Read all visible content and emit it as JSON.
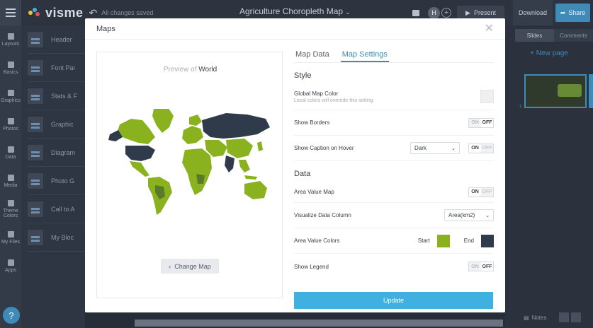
{
  "app": {
    "logo_text": "visme",
    "save_status": "All changes saved",
    "doc_title": "Agriculture Choropleth Map",
    "avatar_initial": "H",
    "present_label": "Present",
    "download_label": "Download",
    "share_label": "Share"
  },
  "rail": {
    "items": [
      "Layouts",
      "Basics",
      "Graphics",
      "Photos",
      "Data",
      "Media",
      "Theme Colors",
      "My Files",
      "Apps"
    ],
    "help_label": "?"
  },
  "panel": {
    "items": [
      "Header",
      "Font Pai",
      "Stats & F",
      "Graphic",
      "Diagram",
      "Photo G",
      "Call to A",
      "My Bloc"
    ]
  },
  "slides_panel": {
    "tabs": [
      "Slides",
      "Comments"
    ],
    "new_page_label": "+ New page",
    "slide_number": "1",
    "notes_label": "Notes"
  },
  "modal": {
    "title": "Maps",
    "close_icon": "close-icon",
    "preview": {
      "prefix": "Preview of",
      "map_name": "World",
      "change_map_label": "Change Map"
    },
    "tabs": [
      "Map Data",
      "Map Settings"
    ],
    "active_tab": "Map Settings",
    "style_section": "Style",
    "global_color_label": "Global Map Color",
    "global_color_sub": "Local colors will override this setting",
    "show_borders_label": "Show Borders",
    "show_caption_label": "Show Caption on Hover",
    "caption_theme_value": "Dark",
    "data_section": "Data",
    "area_value_map_label": "Area Value Map",
    "visualize_label": "Visualize Data Column",
    "visualize_value": "Area(km2)",
    "area_colors_label": "Area Value Colors",
    "start_label": "Start",
    "end_label": "End",
    "start_color": "#8ab21e",
    "end_color": "#2f3a4a",
    "show_legend_label": "Show Legend",
    "toggle_on": "ON",
    "toggle_off": "OFF",
    "update_label": "Update"
  }
}
